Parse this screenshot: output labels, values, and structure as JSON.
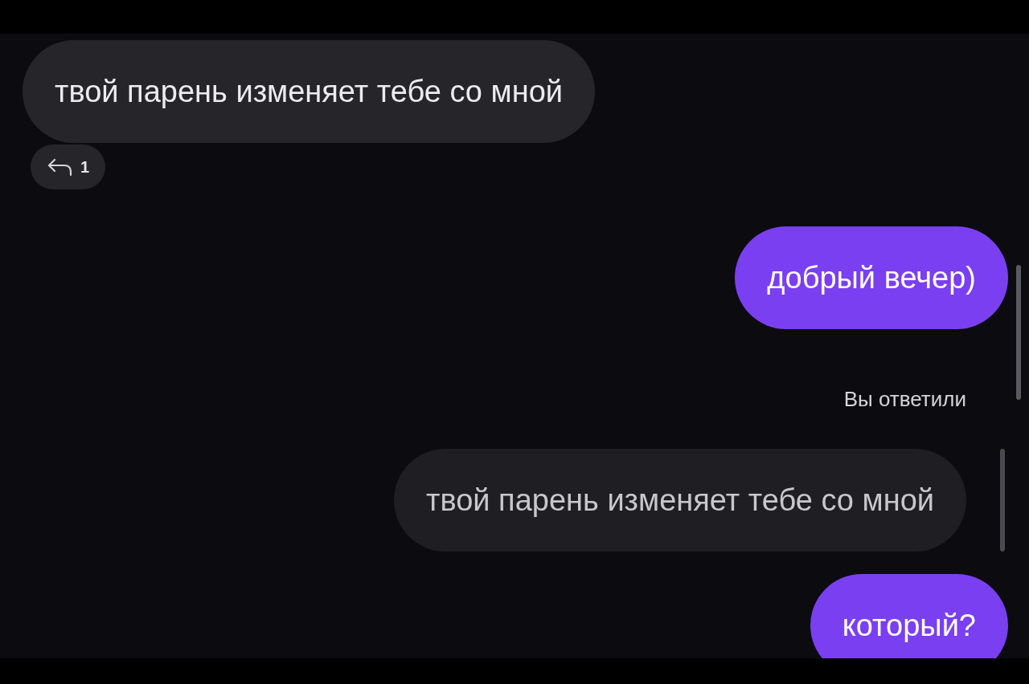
{
  "messages": [
    {
      "kind": "incoming",
      "text": "твой парень изменяет тебе со мной",
      "reply_count": "1"
    },
    {
      "kind": "outgoing",
      "text": "добрый вечер)"
    },
    {
      "kind": "reply_label",
      "text": "Вы ответили"
    },
    {
      "kind": "quoted",
      "text": "твой парень изменяет тебе со мной"
    },
    {
      "kind": "outgoing",
      "text": "который?"
    }
  ]
}
